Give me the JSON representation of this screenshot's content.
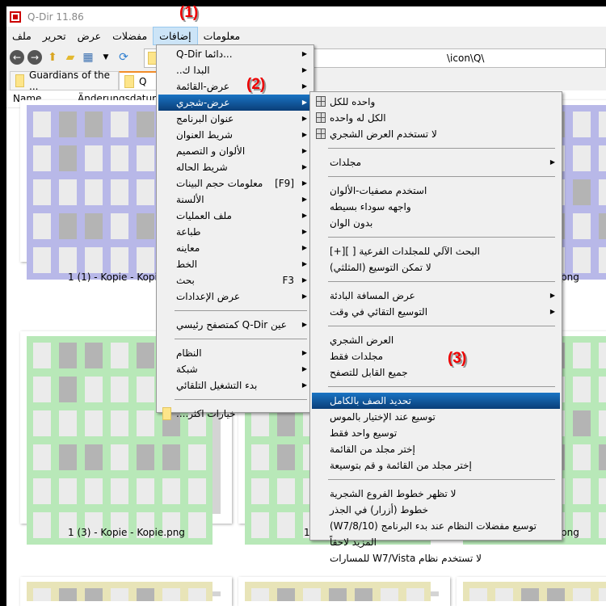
{
  "window": {
    "title": "Q-Dir 11.86"
  },
  "menubar": [
    "ملف",
    "تحرير",
    "عرض",
    "مفضلات",
    "إضافات",
    "معلومات"
  ],
  "address": {
    "value": "\\icon\\Q\\"
  },
  "tabs": [
    "Guardians of the ...",
    "Q"
  ],
  "columns": [
    "Name",
    "Änderungsdatum"
  ],
  "captions": {
    "r1c1": "1 (1) - Kopie - Kopie.png",
    "r1c3": "png",
    "r2c1": "1 (3) - Kopie - Kopie.png",
    "r2c2": "1",
    "r2c3": "png"
  },
  "annotations": [
    "(1)",
    "(2)",
    "(3)"
  ],
  "menu_extras": [
    {
      "label": "Q-Dir دائما...",
      "sub": true
    },
    {
      "label": "البدا ك..",
      "sub": true
    },
    {
      "label": "عرض-القائمة",
      "sub": true
    },
    {
      "label": "عرض-شجري",
      "sub": true,
      "hl": true
    },
    {
      "label": "عنوان البرنامج",
      "sub": true
    },
    {
      "label": "شريط العنوان",
      "sub": true
    },
    {
      "label": "الألوان و التصميم",
      "sub": true
    },
    {
      "label": "شريط الحاله",
      "sub": true
    },
    {
      "label": "معلومات حجم البينات",
      "shortcut": "[F9]",
      "sub": true
    },
    {
      "label": "الألسنة",
      "sub": true
    },
    {
      "label": "ملف العمليات",
      "sub": true
    },
    {
      "label": "طباعة",
      "sub": true
    },
    {
      "label": "معاينه",
      "sub": true
    },
    {
      "label": "الخط",
      "sub": true
    },
    {
      "label": "بحث",
      "shortcut": "F3",
      "sub": true
    },
    {
      "label": "عرض الإعدادات",
      "sub": true
    },
    {
      "sep": true
    },
    {
      "label": "عين Q-Dir كمتصفح رئيسي",
      "sub": true
    },
    {
      "sep": true
    },
    {
      "label": "النظام",
      "sub": true
    },
    {
      "label": "شبكة",
      "sub": true
    },
    {
      "label": "بدء التشغيل التلقائي",
      "sub": true
    },
    {
      "sep": true
    },
    {
      "label": "خيارات اكثر....",
      "icon": "fold"
    }
  ],
  "menu_tree": [
    {
      "label": "واحده للكل",
      "icon": "grid"
    },
    {
      "label": "الكل له واحده",
      "icon": "grid"
    },
    {
      "label": "لا تستخدم العرض الشجري",
      "icon": "grid"
    },
    {
      "sep": true
    },
    {
      "label": "مجلدات",
      "sub": true
    },
    {
      "sep": true
    },
    {
      "label": "استخدم مصفيات-الألوان"
    },
    {
      "label": "واجهه سوداء بسيطه"
    },
    {
      "label": "بدون الوان"
    },
    {
      "sep": true
    },
    {
      "label": "البحث الآلي للمجلدات الفرعية [ ][+]"
    },
    {
      "label": "لا تمكن التوسيع (المثلثي)"
    },
    {
      "sep": true
    },
    {
      "label": "عرض المسافة البادئة",
      "sub": true
    },
    {
      "label": "التوسيع التقائي في وقت",
      "sub": true
    },
    {
      "sep": true
    },
    {
      "label": "العرض الشجري"
    },
    {
      "label": "مجلدات فقط"
    },
    {
      "label": "جميع القابل للتصفح"
    },
    {
      "sep": true
    },
    {
      "label": "تحديد الصف بالكامل",
      "hl": true
    },
    {
      "label": "توسيع عند الإختيار بالموس"
    },
    {
      "label": "توسيع واحد فقط"
    },
    {
      "label": "إختر مجلد من القائمة"
    },
    {
      "label": "إختر مجلد من القائمة و قم بتوسيعة"
    },
    {
      "sep": true
    },
    {
      "label": "لا تظهر خطوط الفروع الشجرية"
    },
    {
      "label": "خطوط (أزرار) في الجذر"
    },
    {
      "label": "(W7/8/10) توسيع مفضلات النظام عند بدء البرنامج"
    },
    {
      "label": "المزيد  لاحقاً"
    },
    {
      "label": "لا تستخدم نظام W7/Vista للمسارات"
    }
  ],
  "colors": {
    "purple": "#b8b8e8",
    "green": "#b8e8b8",
    "yellow": "#e8e4b8",
    "highlight": "#0a5aa8"
  }
}
